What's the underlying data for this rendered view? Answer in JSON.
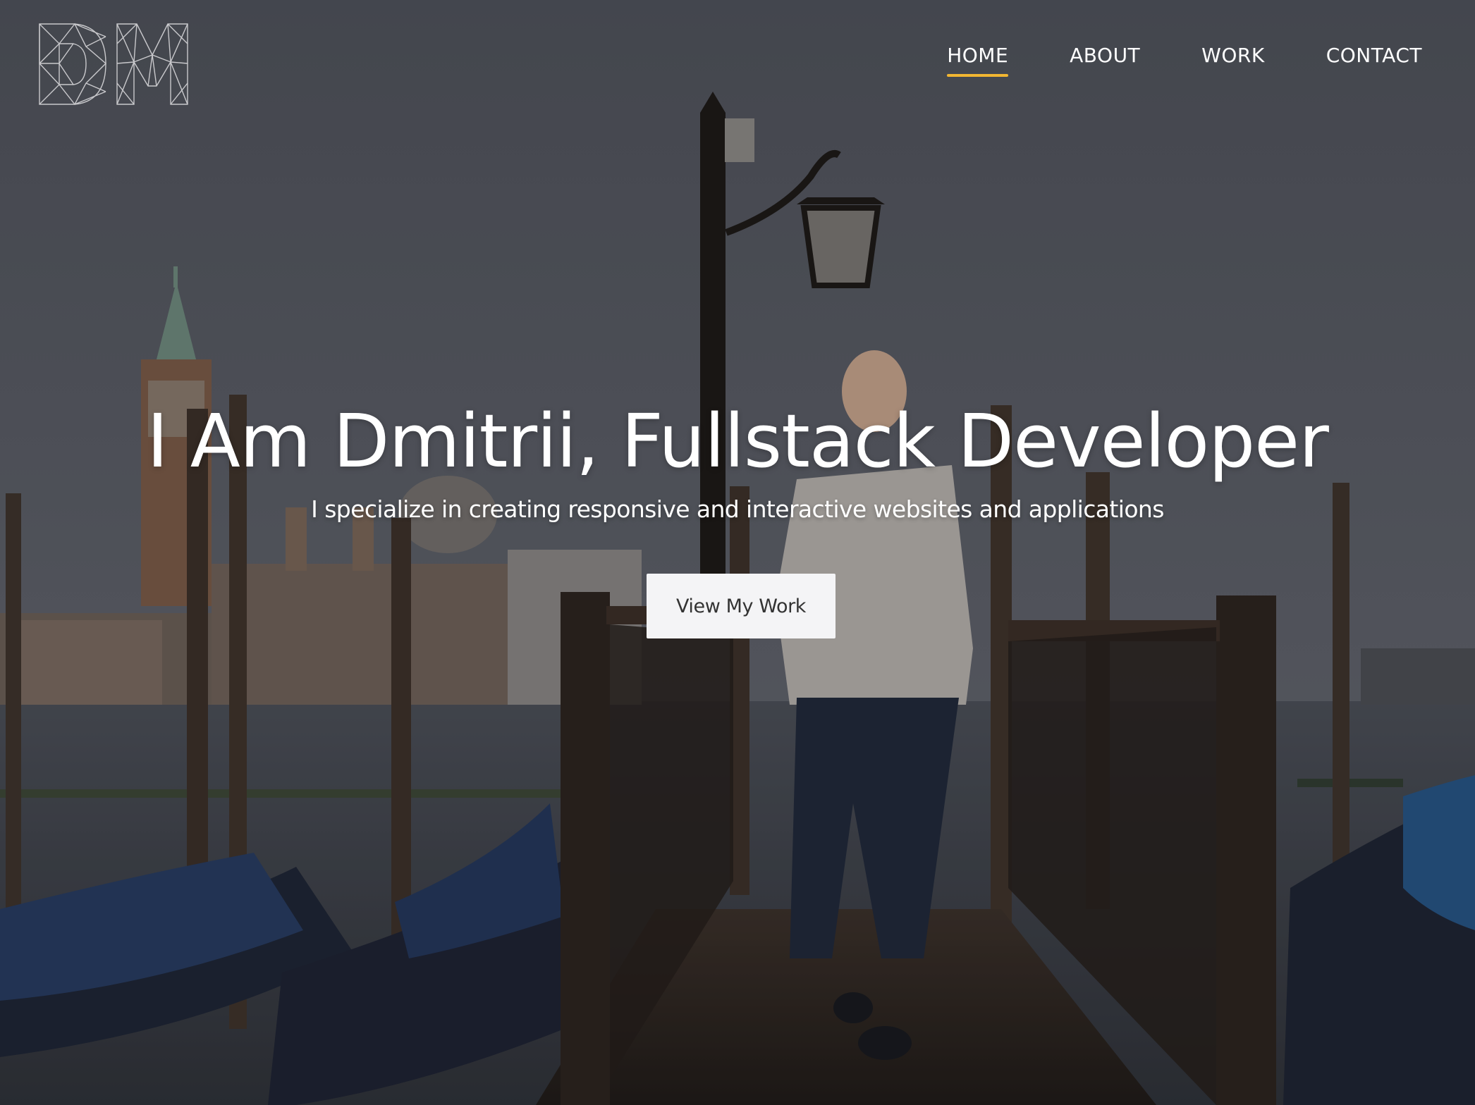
{
  "logo": {
    "text": "DM"
  },
  "nav": {
    "items": [
      {
        "label": "HOME",
        "active": true
      },
      {
        "label": "ABOUT",
        "active": false
      },
      {
        "label": "WORK",
        "active": false
      },
      {
        "label": "CONTACT",
        "active": false
      }
    ],
    "active_underline_color": "#f2b632"
  },
  "hero": {
    "title": "I Am Dmitrii, Fullstack Developer",
    "subtitle": "I specialize in creating responsive and interactive websites and applications",
    "cta_label": "View My Work"
  },
  "colors": {
    "text": "#ffffff",
    "button_bg": "#f4f4f6",
    "button_text": "#333333"
  }
}
